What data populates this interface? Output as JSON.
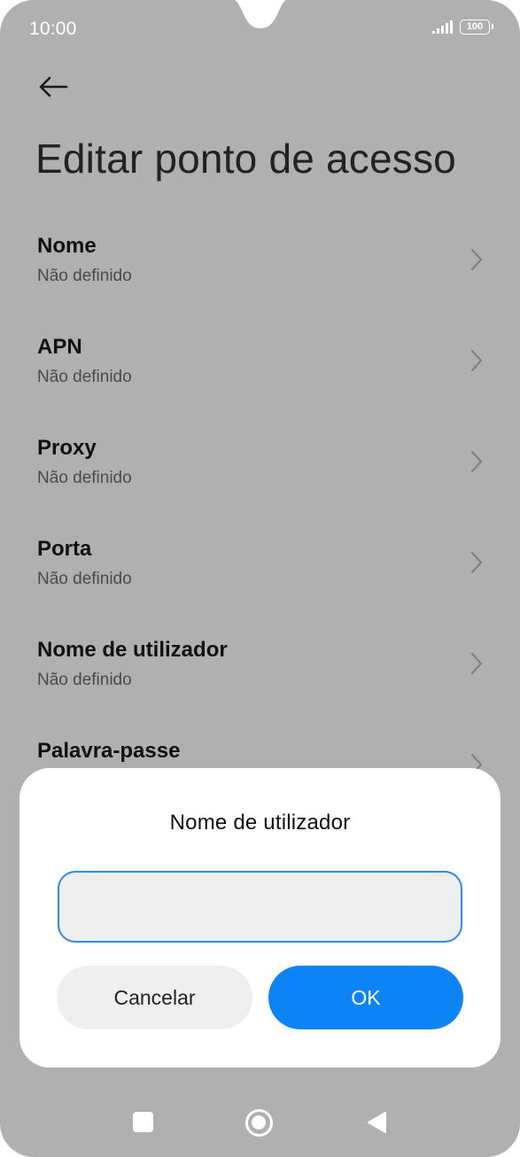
{
  "status_bar": {
    "time": "10:00",
    "battery": "100"
  },
  "header": {
    "title": "Editar ponto de acesso"
  },
  "settings": [
    {
      "title": "Nome",
      "value": "Não definido"
    },
    {
      "title": "APN",
      "value": "Não definido"
    },
    {
      "title": "Proxy",
      "value": "Não definido"
    },
    {
      "title": "Porta",
      "value": "Não definido"
    },
    {
      "title": "Nome de utilizador",
      "value": "Não definido"
    },
    {
      "title": "Palavra-passe",
      "value": ""
    }
  ],
  "dialog": {
    "title": "Nome de utilizador",
    "input_value": "",
    "cancel_label": "Cancelar",
    "ok_label": "OK"
  },
  "colors": {
    "accent": "#0d84f5",
    "input_border": "#2a8bf0",
    "overlay_background": "#b0b0b0"
  },
  "icons": {
    "back": "arrow-left-icon",
    "chevron": "chevron-right-icon",
    "signal": "signal-icon",
    "battery": "battery-icon",
    "nav_recents": "square-icon",
    "nav_home": "circle-icon",
    "nav_back": "triangle-back-icon"
  }
}
